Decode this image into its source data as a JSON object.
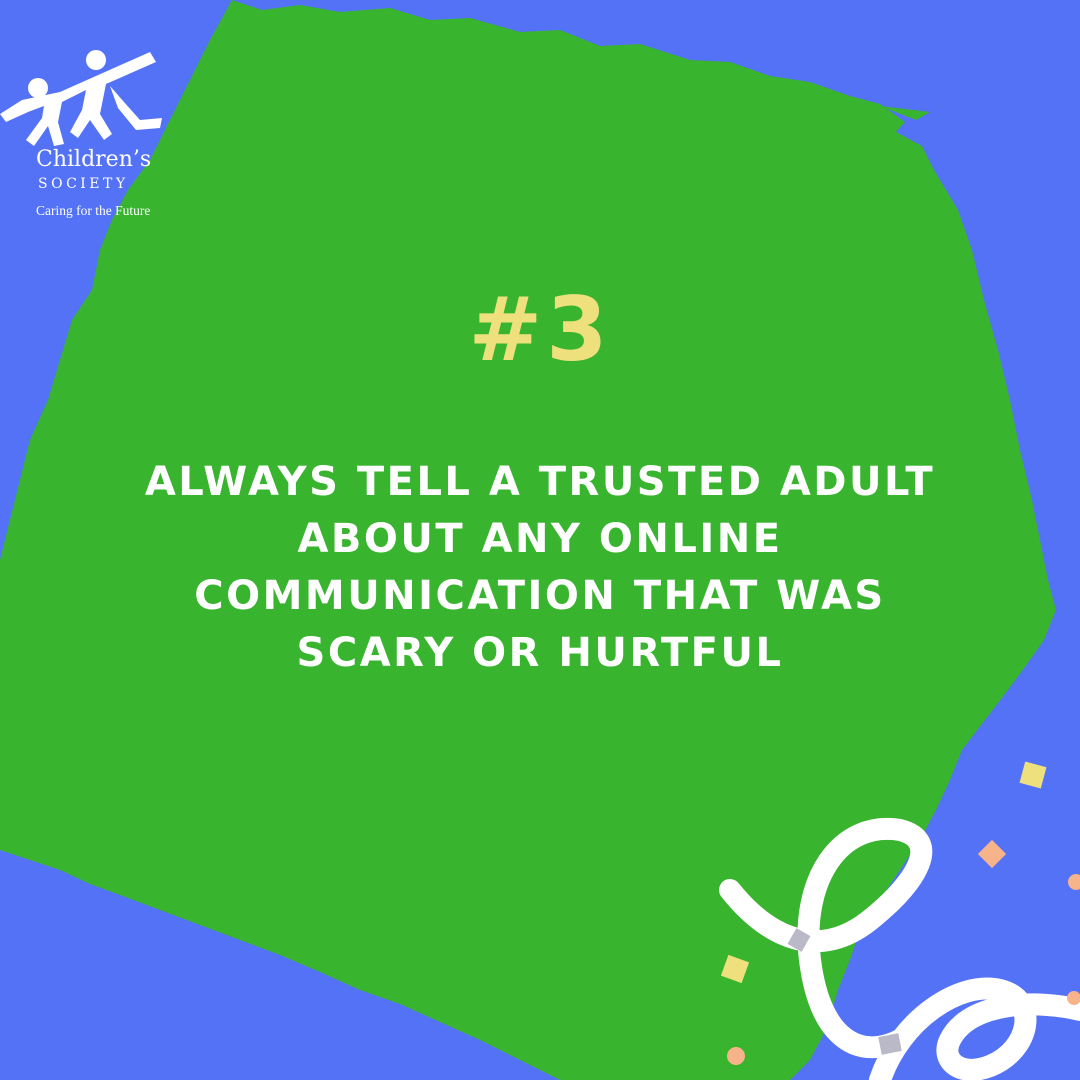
{
  "logo": {
    "name": "Children’s",
    "society": "SOCIETY",
    "tagline": "Caring for the Future",
    "icon": "two-children-holding-hands-icon"
  },
  "tip": {
    "number": "#3",
    "text": "ALWAYS TELL A TRUSTED ADULT ABOUT ANY ONLINE COMMUNICATION THAT WAS SCARY OR HURTFUL"
  },
  "colors": {
    "background": "#5472f5",
    "paint_patch": "#38b42f",
    "number": "#efe07e",
    "text": "#ffffff",
    "confetti_yellow": "#efe07e",
    "confetti_peach": "#f7b389",
    "streamer": "#ffffff"
  }
}
